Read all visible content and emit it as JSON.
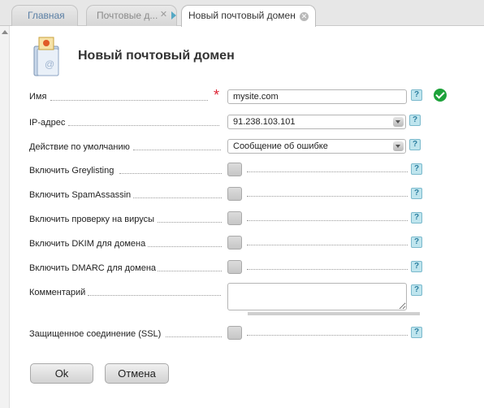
{
  "tabs": [
    {
      "label": "Главная"
    },
    {
      "label": "Почтовые д..."
    },
    {
      "label": "Новый почтовый домен"
    }
  ],
  "form": {
    "title": "Новый почтовый домен",
    "icon": "mail-domain-icon",
    "fields": {
      "name": {
        "label": "Имя",
        "value": "mysite.com",
        "required_mark": "*"
      },
      "ip": {
        "label": "IP-адрес",
        "value": "91.238.103.101"
      },
      "default_action": {
        "label": "Действие по умолчанию",
        "value": "Сообщение об ошибке"
      },
      "greylisting": {
        "label": "Включить Greylisting",
        "checked": false
      },
      "spamassassin": {
        "label": "Включить SpamAssassin",
        "checked": false
      },
      "antivirus": {
        "label": "Включить проверку на вирусы",
        "checked": false
      },
      "dkim": {
        "label": "Включить DKIM для домена",
        "checked": false
      },
      "dmarc": {
        "label": "Включить DMARC для домена",
        "checked": false
      },
      "comment": {
        "label": "Комментарий",
        "value": ""
      },
      "ssl": {
        "label": "Защищенное соединение (SSL)",
        "checked": false
      }
    },
    "help_glyph": "?",
    "buttons": {
      "ok": "Ok",
      "cancel": "Отмена"
    }
  },
  "colors": {
    "help_bg": "#bfe5ee",
    "valid": "#1da23a",
    "required": "#dd2233",
    "tab_link": "#5a7fa5"
  }
}
